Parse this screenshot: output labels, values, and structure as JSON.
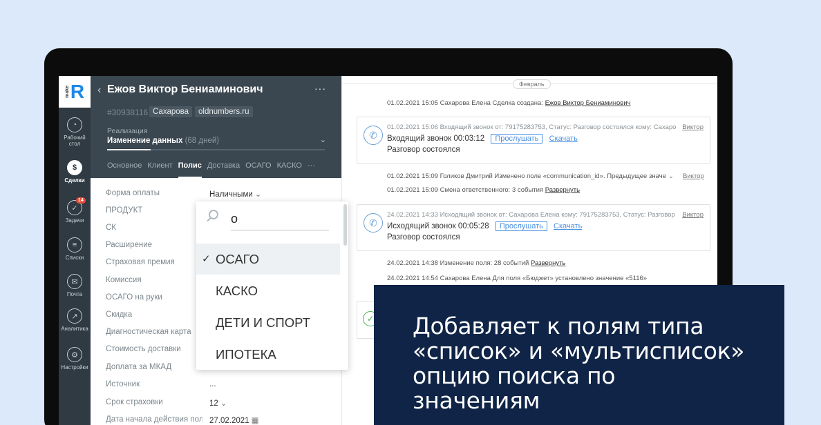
{
  "deal": {
    "title": "Ежов Виктор Бениаминович",
    "more": "···",
    "id": "#30938116",
    "tags": [
      "Сахарова",
      "oldnumbers.ru"
    ],
    "stage_label": "Реализация",
    "stage_name": "Изменение данных",
    "stage_days": "(68 дней)",
    "stage_progress": 0.2,
    "tabs": [
      "Основное",
      "Клиент",
      "Полис",
      "Доставка",
      "ОСАГО",
      "КАСКО",
      "···"
    ],
    "active_tab": "Полис"
  },
  "rail": [
    {
      "label": "Рабочий стол",
      "icon": "dashboard-icon"
    },
    {
      "label": "Сделки",
      "icon": "deals-icon",
      "active": true
    },
    {
      "label": "Задачи",
      "icon": "tasks-icon",
      "badge": "14"
    },
    {
      "label": "Списки",
      "icon": "lists-icon"
    },
    {
      "label": "Почта",
      "icon": "mail-icon"
    },
    {
      "label": "Аналитика",
      "icon": "analytics-icon"
    },
    {
      "label": "Настройки",
      "icon": "settings-icon"
    }
  ],
  "fields": [
    {
      "label": "Форма оплаты",
      "value": "Наличными"
    },
    {
      "label": "ПРОДУКТ",
      "value": ""
    },
    {
      "label": "СК",
      "value": ""
    },
    {
      "label": "Расширение",
      "value": ""
    },
    {
      "label": "Страховая премия",
      "value": ""
    },
    {
      "label": "Комиссия",
      "value": ""
    },
    {
      "label": "ОСАГО на руки",
      "value": ""
    },
    {
      "label": "Скидка",
      "value": ""
    },
    {
      "label": "Диагностическая карта",
      "value": ""
    },
    {
      "label": "Стоимость доставки",
      "value": ""
    },
    {
      "label": "Доплата за МКАД",
      "value": ""
    },
    {
      "label": "Источник",
      "value": "..."
    },
    {
      "label": "Срок страховки",
      "value": "12"
    },
    {
      "label": "Дата начала действия поли",
      "value": "27.02.2021"
    }
  ],
  "dropdown": {
    "query": "о",
    "options": [
      "ОСАГО",
      "КАСКО",
      "ДЕТИ И СПОРТ",
      "ИПОТЕКА"
    ],
    "selected": "ОСАГО"
  },
  "timeline": {
    "month": "Февраль",
    "e1": {
      "text": "01.02.2021 15:05 Сахарова Елена  Сделка создана: ",
      "link": "Ежов Виктор Бениаминович"
    },
    "call1": {
      "meta": "01.02.2021 15:06 Входящий звонок от: 79175283753, Статус: Разговор состоялся кому: Сахарова",
      "user": "Виктор",
      "title": "Входящий звонок 00:03:12",
      "listen": "Прослушать",
      "download": "Скачать",
      "status": "Разговор состоялся"
    },
    "e2": {
      "text": "01.02.2021 15:09 Голиков Дмитрий  Изменено поле «communication_id». Предыдущее значе",
      "user": "Виктор"
    },
    "e3": {
      "text": "01.02.2021 15:09 Смена ответственного: 3 события ",
      "link": "Развернуть"
    },
    "call2": {
      "meta": "24.02.2021 14:33 Исходящий звонок от: Сахарова Елена кому: 79175283753, Статус: Разговор",
      "user": "Виктор",
      "title": "Исходящий звонок 00:05:28",
      "listen": "Прослушать",
      "download": "Скачать",
      "status": "Разговор состоялся"
    },
    "e4": {
      "text": "24.02.2021 14:38 Изменение поля: 28 событий ",
      "link": "Развернуть"
    },
    "e5": {
      "text": "24.02.2021 14:54 Сахарова Елена  Для поля «Бюджет» установлено значение «5116»"
    }
  },
  "banner": {
    "line1": "Добавляет к полям типа",
    "line2": "«список» и «мультисписок»",
    "line3": "опцию поиска по значениям"
  },
  "colors": {
    "background": "#dce9fb",
    "deal_header": "#3a4750",
    "rail": "#2f3a42",
    "banner": "#0f2446",
    "accent": "#4a90e2"
  }
}
